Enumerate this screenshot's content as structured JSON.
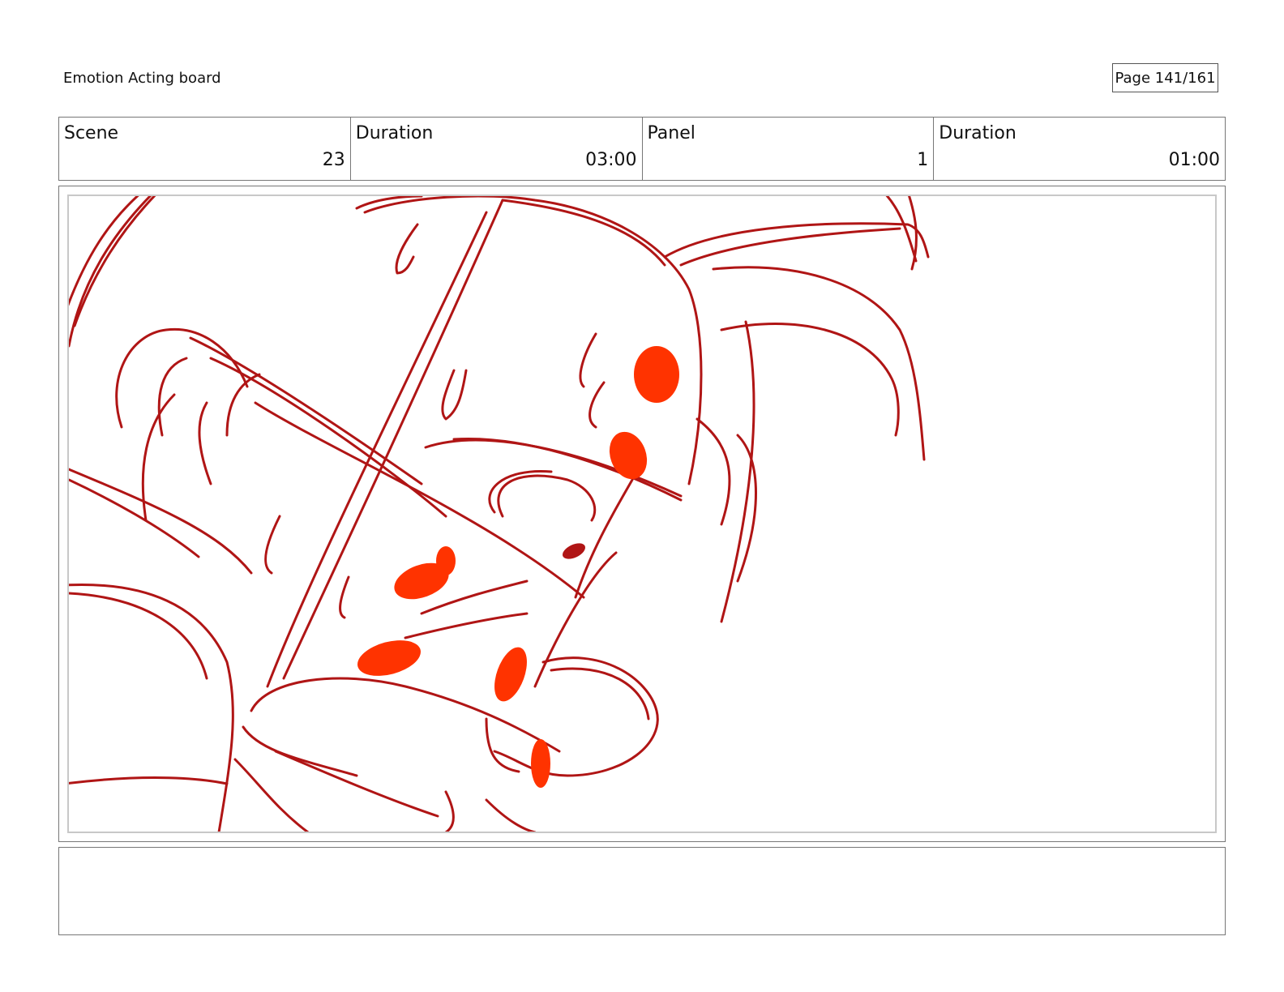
{
  "header": {
    "title": "Emotion Acting board",
    "page_label": "Page 141/161"
  },
  "info": {
    "scene_label": "Scene",
    "scene_value": "23",
    "scene_duration_label": "Duration",
    "scene_duration_value": "03:00",
    "panel_label": "Panel",
    "panel_value": "1",
    "panel_duration_label": "Duration",
    "panel_duration_value": "01:00"
  },
  "panel": {
    "sketch_color": "#b01515",
    "accent_color": "#ff3300"
  },
  "notes": {
    "text": ""
  }
}
